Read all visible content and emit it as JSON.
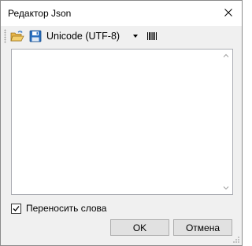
{
  "window": {
    "title": "Редактор Json"
  },
  "toolbar": {
    "open_icon": "open-folder-icon",
    "save_icon": "save-disk-icon",
    "encoding_value": "Unicode (UTF-8)",
    "format_icon": "barcode-icon"
  },
  "editor": {
    "text": ""
  },
  "options": {
    "word_wrap_label": "Переносить слова",
    "word_wrap_checked": true
  },
  "buttons": {
    "ok_label": "OK",
    "cancel_label": "Отмена"
  },
  "colors": {
    "accent_blue": "#2a6fbf",
    "folder_yellow": "#e8b64a"
  }
}
